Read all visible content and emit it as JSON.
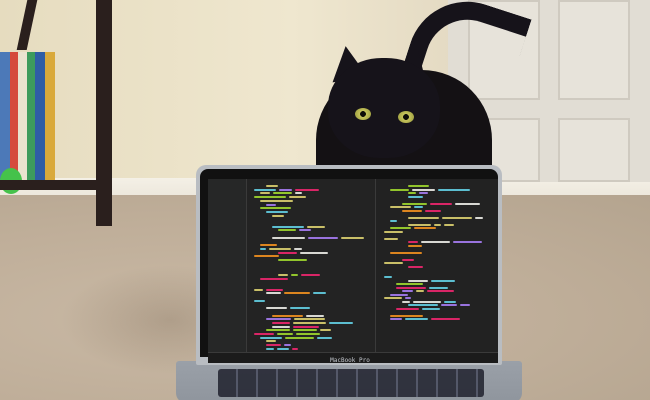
{
  "photo": {
    "brand": "MacBook Pro"
  }
}
